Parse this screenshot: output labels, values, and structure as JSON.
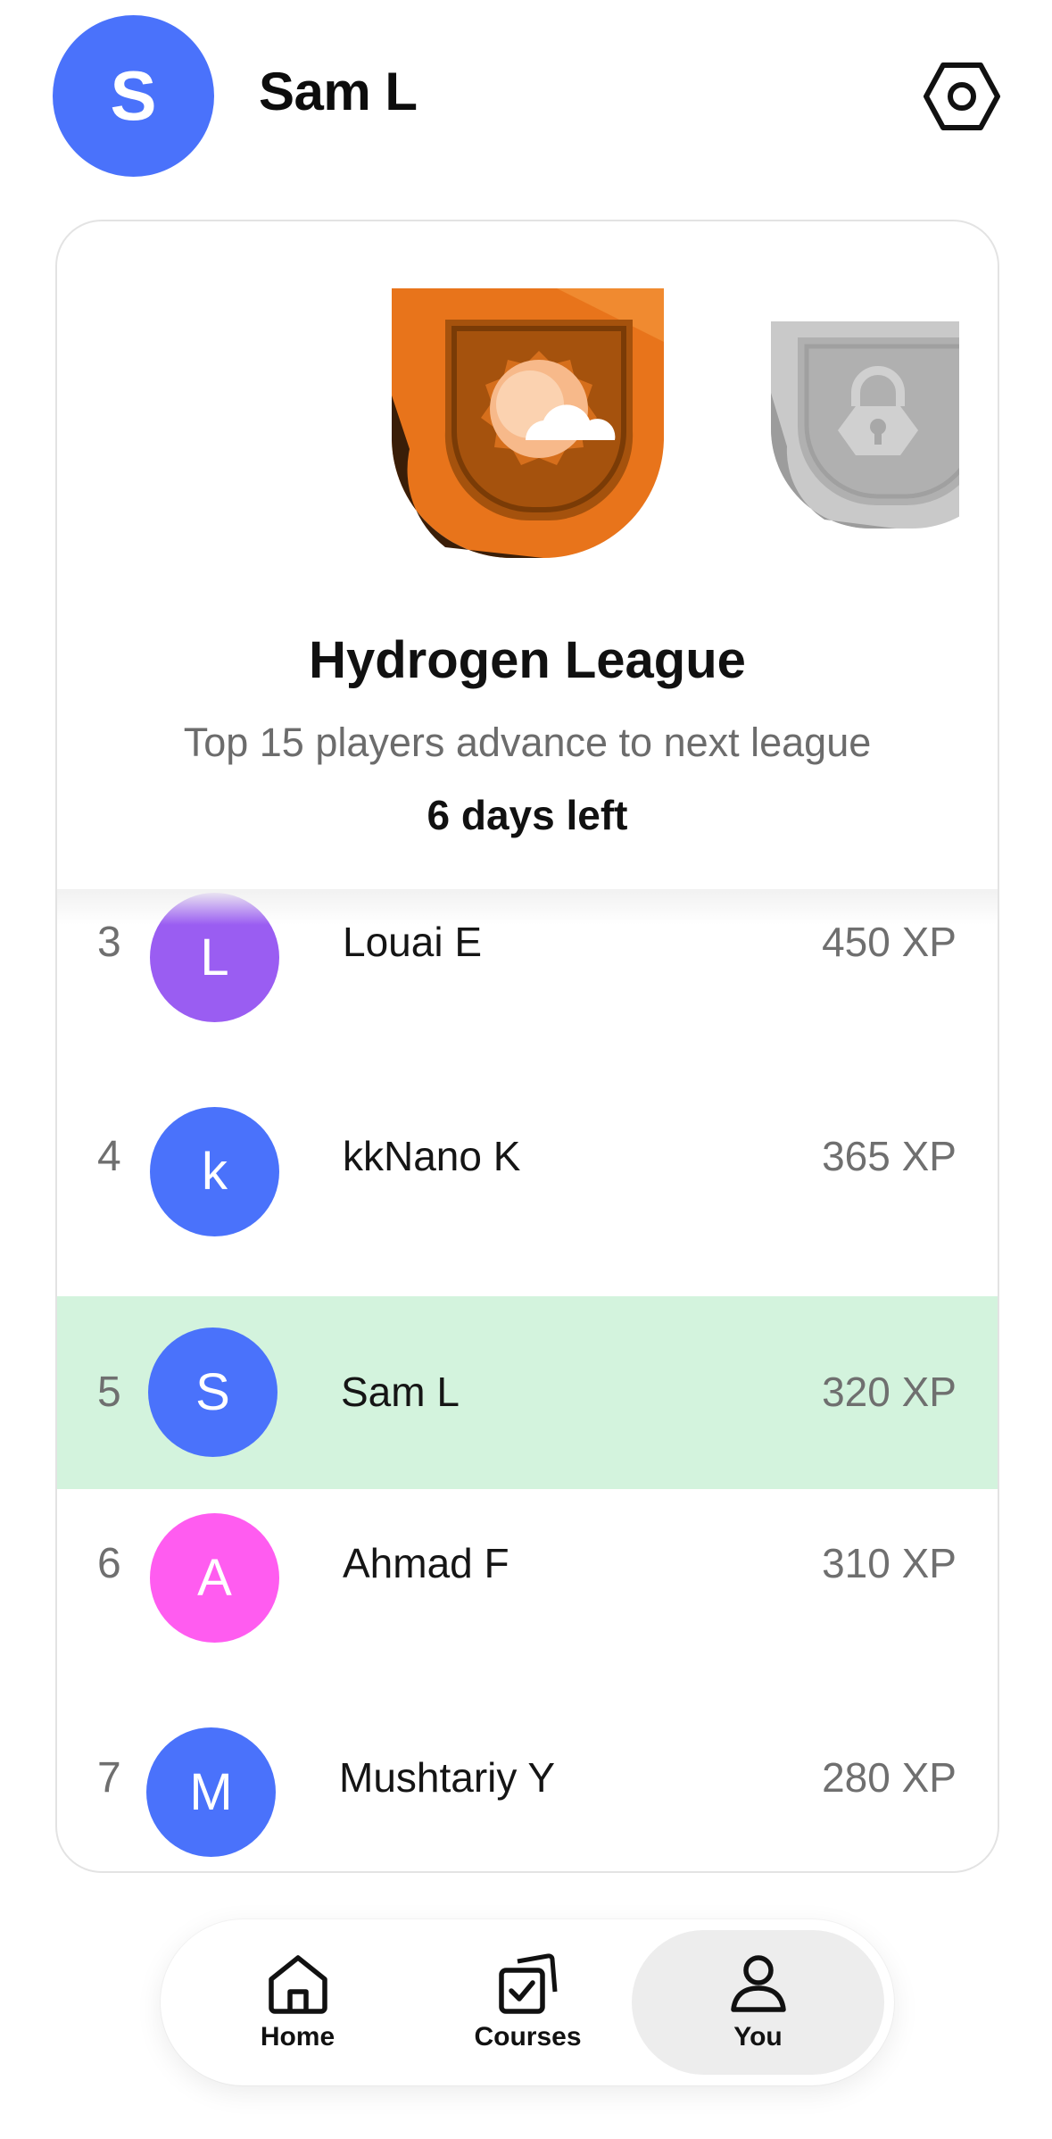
{
  "header": {
    "avatar_initial": "S",
    "user_name": "Sam L",
    "settings_icon": "settings-hexagon-icon",
    "avatar_color": "#4a72fb"
  },
  "league": {
    "current_badge_icon": "hydrogen-league-badge-icon",
    "next_badge_icon": "locked-league-badge-icon",
    "title": "Hydrogen League",
    "subtitle": "Top 15 players advance to next league",
    "days_left": "6 days left"
  },
  "leaderboard": [
    {
      "rank": "3",
      "initial": "L",
      "name": "Louai E",
      "xp": "450 XP",
      "avatar_color": "#9a5df2"
    },
    {
      "rank": "4",
      "initial": "k",
      "name": "kkNano K",
      "xp": "365 XP",
      "avatar_color": "#4a72fb"
    },
    {
      "rank": "5",
      "initial": "S",
      "name": "Sam L",
      "xp": "320 XP",
      "avatar_color": "#4a72fb",
      "is_current_user": true
    },
    {
      "rank": "6",
      "initial": "A",
      "name": "Ahmad F",
      "xp": "310 XP",
      "avatar_color": "#ff5cf0"
    },
    {
      "rank": "7",
      "initial": "M",
      "name": "Mushtariy Y",
      "xp": "280 XP",
      "avatar_color": "#4a72fb"
    }
  ],
  "nav": {
    "items": [
      {
        "label": "Home",
        "icon": "home-icon"
      },
      {
        "label": "Courses",
        "icon": "courses-icon"
      },
      {
        "label": "You",
        "icon": "profile-icon",
        "active": true
      }
    ]
  },
  "colors": {
    "highlight_row": "#d3f3dd",
    "badge_orange": "#e8741b",
    "locked_gray": "#b9b9b9"
  }
}
